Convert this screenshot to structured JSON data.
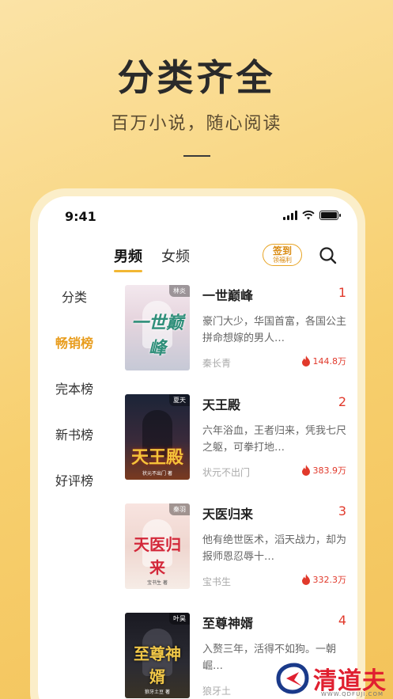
{
  "hero": {
    "title": "分类齐全",
    "subtitle": "百万小说，随心阅读"
  },
  "status_bar": {
    "time": "9:41"
  },
  "tabs": [
    {
      "label": "男频",
      "active": true
    },
    {
      "label": "女频",
      "active": false
    }
  ],
  "signin": {
    "label": "签到",
    "sublabel": "领福利"
  },
  "sidebar": {
    "items": [
      {
        "label": "分类",
        "active": false
      },
      {
        "label": "畅销榜",
        "active": true
      },
      {
        "label": "完本榜",
        "active": false
      },
      {
        "label": "新书榜",
        "active": false
      },
      {
        "label": "好评榜",
        "active": false
      }
    ]
  },
  "books": [
    {
      "title": "一世巅峰",
      "rank": "1",
      "description": "豪门大少，华国首富，各国公主拼命想嫁的男人…",
      "author": "秦长青",
      "heat": "144.8万",
      "cover_title": "一世巅峰",
      "cover_tag": "林炎",
      "cover_author": ""
    },
    {
      "title": "天王殿",
      "rank": "2",
      "description": "六年浴血，王者归来，凭我七尺之躯，可拳打地…",
      "author": "状元不出门",
      "heat": "383.9万",
      "cover_title": "天王殿",
      "cover_tag": "夏天",
      "cover_author": "状元不出门 著"
    },
    {
      "title": "天医归来",
      "rank": "3",
      "description": "他有绝世医术，滔天战力，却为报师恩忍辱十…",
      "author": "宝书生",
      "heat": "332.3万",
      "cover_title": "天医归来",
      "cover_tag": "秦羽",
      "cover_author": "宝书生 著"
    },
    {
      "title": "至尊神婿",
      "rank": "4",
      "description": "入赘三年，活得不如狗。一朝崛…",
      "author": "狼牙土",
      "heat": "",
      "cover_title": "至尊神婿",
      "cover_tag": "叶昊",
      "cover_author": "狼牙土豆 著"
    }
  ],
  "watermark": {
    "text": "清道夫",
    "url": "WWW.QDFUJI.COM"
  },
  "colors": {
    "accent": "#f2b733",
    "rank_red": "#e1392b",
    "sidebar_active": "#e89c1c"
  }
}
